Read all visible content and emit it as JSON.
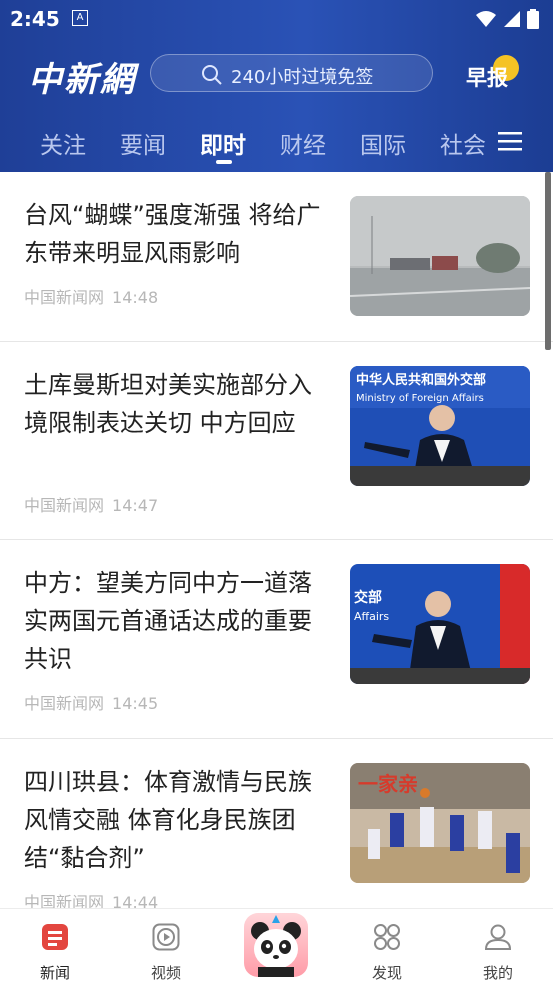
{
  "status_bar": {
    "time": "2:45",
    "notif_letter": "A"
  },
  "header": {
    "logo": "中新網",
    "search_placeholder": "240小时过境免签",
    "morning_label": "早报"
  },
  "tabs": [
    {
      "label": "关注",
      "active": false
    },
    {
      "label": "要闻",
      "active": false
    },
    {
      "label": "即时",
      "active": true
    },
    {
      "label": "财经",
      "active": false
    },
    {
      "label": "国际",
      "active": false
    },
    {
      "label": "社会",
      "active": false
    }
  ],
  "news": [
    {
      "title": "台风“蝴蝶”强度渐强 将给广东带来明显风雨影响",
      "source": "中国新闻网",
      "time": "14:48",
      "image": "typhoon-highway-photo"
    },
    {
      "title": "土库曼斯坦对美实施部分入境限制表达关切 中方回应",
      "source": "中国新闻网",
      "time": "14:47",
      "image": "mfa-press-conference-photo",
      "image_text_line1": "中华人民共和国外交部",
      "image_text_line2": "Ministry of Foreign Affairs"
    },
    {
      "title": "中方：望美方同中方一道落实两国元首通话达成的重要共识",
      "source": "中国新闻网",
      "time": "14:45",
      "image": "mfa-spokesman-photo",
      "image_text_line1": "交部",
      "image_text_line2": "Affairs"
    },
    {
      "title": "四川珙县：体育激情与民族风情交融 体育化身民族团结“黏合剂”",
      "source": "中国新闻网",
      "time": "14:44",
      "image": "basketball-game-photo",
      "image_text_line1": "一家亲"
    }
  ],
  "bottom_nav": [
    {
      "label": "新闻",
      "icon": "news-icon",
      "active": true
    },
    {
      "label": "视频",
      "icon": "video-icon",
      "active": false
    },
    {
      "label": "",
      "icon": "panda-mascot-icon",
      "active": false
    },
    {
      "label": "发现",
      "icon": "discover-icon",
      "active": false
    },
    {
      "label": "我的",
      "icon": "profile-icon",
      "active": false
    }
  ],
  "colors": {
    "header_bg": "#2447a6",
    "nav_active": "#e3463f",
    "meta_gray": "#b7b7b7"
  }
}
